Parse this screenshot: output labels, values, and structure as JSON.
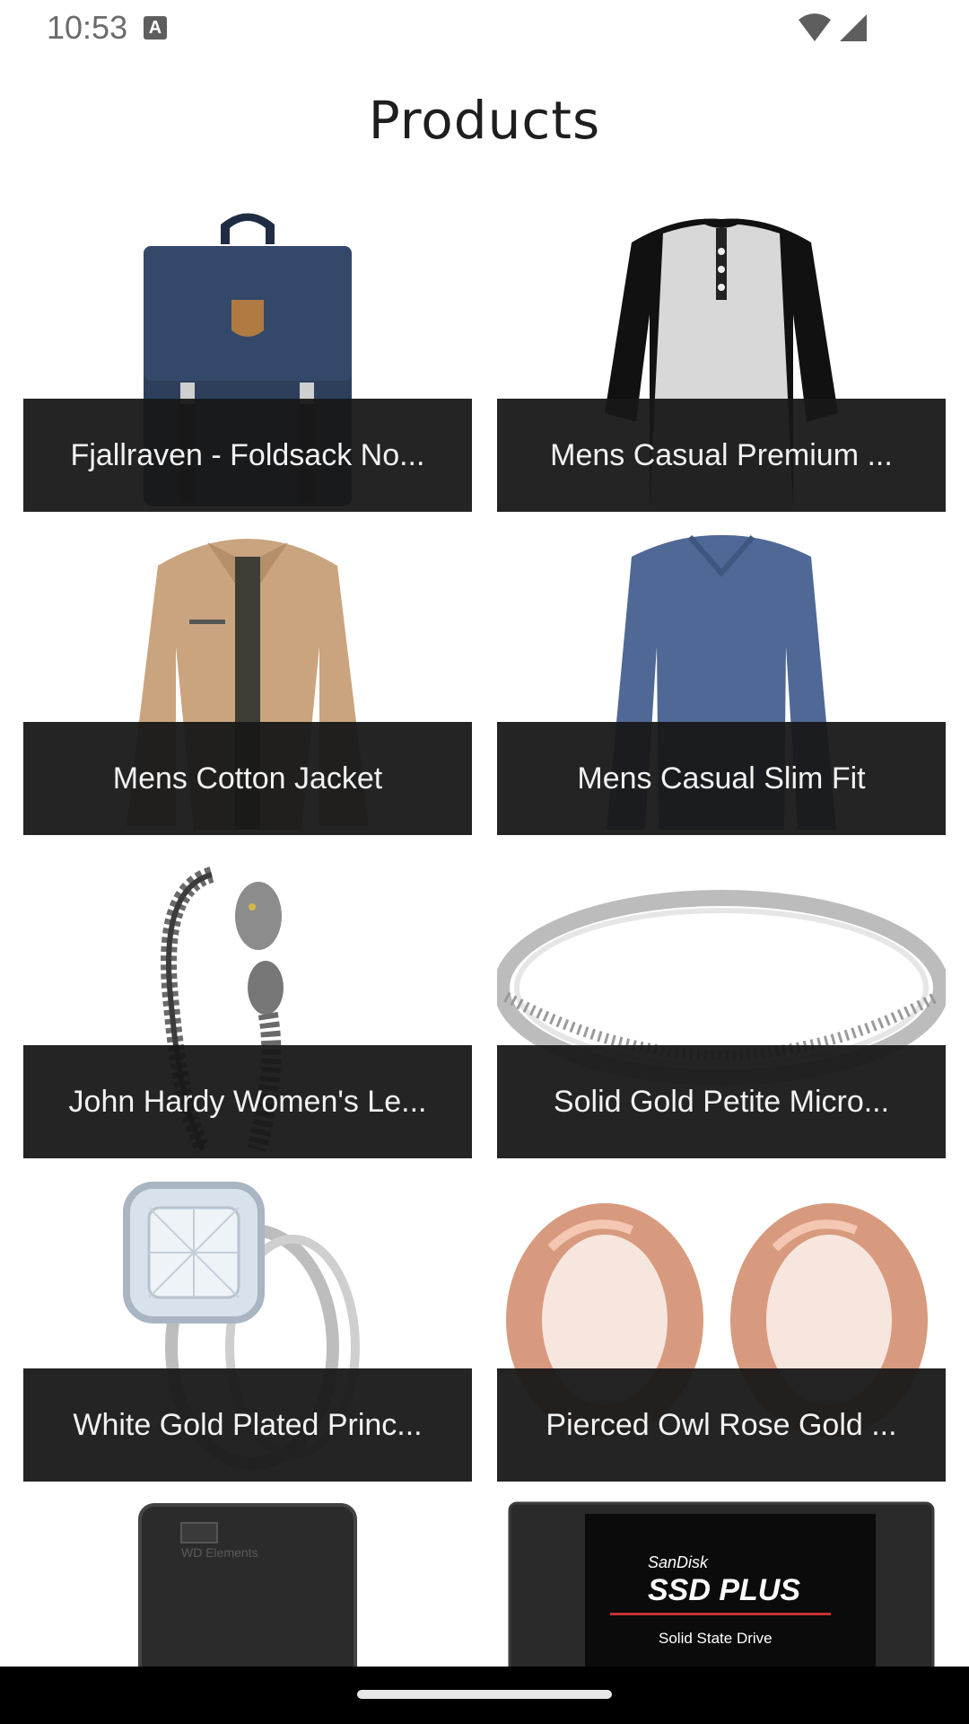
{
  "status_bar": {
    "time": "10:53",
    "a_icon_glyph": "A",
    "icons": [
      "a-icon",
      "wifi-icon",
      "signal-icon"
    ]
  },
  "page": {
    "title": "Products"
  },
  "products": [
    {
      "name": "Fjallraven - Foldsack No...",
      "image_icon": "backpack-image"
    },
    {
      "name": "Mens Casual Premium ...",
      "image_icon": "henley-shirt-image"
    },
    {
      "name": "Mens Cotton Jacket",
      "image_icon": "jacket-image"
    },
    {
      "name": "Mens Casual Slim Fit",
      "image_icon": "longsleeve-shirt-image"
    },
    {
      "name": "John Hardy Women's Le...",
      "image_icon": "dragon-bracelet-image"
    },
    {
      "name": "Solid Gold Petite Micro...",
      "image_icon": "gold-ring-image"
    },
    {
      "name": "White Gold Plated Princ...",
      "image_icon": "diamond-ring-image"
    },
    {
      "name": "Pierced Owl Rose Gold ...",
      "image_icon": "rose-gold-plugs-image"
    }
  ],
  "partial_row": {
    "hdd_label": "WD Elements",
    "ssd_brand": "SanDisk",
    "ssd_name": "SSD PLUS",
    "ssd_sub": "Solid State Drive"
  },
  "colors": {
    "caption_bg": "#1a1a1a",
    "caption_text": "#f2f2f2",
    "title": "#1e1e1e"
  }
}
